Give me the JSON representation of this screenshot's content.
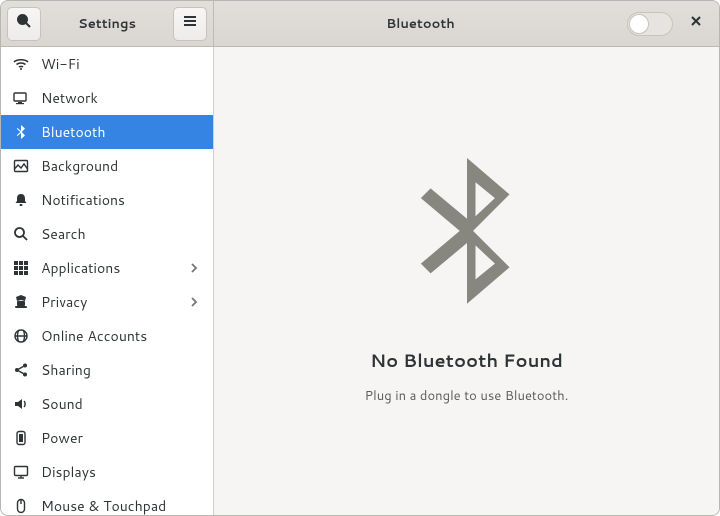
{
  "titlebar": {
    "left_title": "Settings",
    "right_title": "Bluetooth",
    "toggle_state": "off"
  },
  "sidebar": {
    "selected_index": 2,
    "items": [
      {
        "id": "wifi",
        "label": "Wi-Fi",
        "icon": "wifi",
        "chevron": false
      },
      {
        "id": "network",
        "label": "Network",
        "icon": "network",
        "chevron": false
      },
      {
        "id": "bluetooth",
        "label": "Bluetooth",
        "icon": "bluetooth",
        "chevron": false
      },
      {
        "id": "background",
        "label": "Background",
        "icon": "background",
        "chevron": false
      },
      {
        "id": "notifications",
        "label": "Notifications",
        "icon": "bell",
        "chevron": false
      },
      {
        "id": "search",
        "label": "Search",
        "icon": "search",
        "chevron": false
      },
      {
        "id": "applications",
        "label": "Applications",
        "icon": "apps",
        "chevron": true
      },
      {
        "id": "privacy",
        "label": "Privacy",
        "icon": "privacy",
        "chevron": true
      },
      {
        "id": "online",
        "label": "Online Accounts",
        "icon": "online",
        "chevron": false
      },
      {
        "id": "sharing",
        "label": "Sharing",
        "icon": "share",
        "chevron": false
      },
      {
        "id": "sound",
        "label": "Sound",
        "icon": "sound",
        "chevron": false
      },
      {
        "id": "power",
        "label": "Power",
        "icon": "power",
        "chevron": false
      },
      {
        "id": "displays",
        "label": "Displays",
        "icon": "displays",
        "chevron": false
      },
      {
        "id": "mouse",
        "label": "Mouse & Touchpad",
        "icon": "mouse",
        "chevron": false
      }
    ]
  },
  "content": {
    "title": "No Bluetooth Found",
    "subtitle": "Plug in a dongle to use Bluetooth."
  }
}
